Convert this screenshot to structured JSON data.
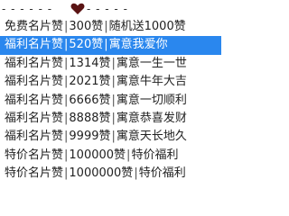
{
  "header": {
    "left_dashes": "- - - - - -",
    "right_dashes": "- - - - -",
    "heart_icon": "heart-icon"
  },
  "menu": {
    "items": [
      {
        "name": "免费名片赞",
        "count": "300赞",
        "desc": "随机送1000赞",
        "selected": false
      },
      {
        "name": "福利名片赞",
        "count": "520赞",
        "desc": "寓意我爱你",
        "selected": true
      },
      {
        "name": "福利名片赞",
        "count": "1314赞",
        "desc": "寓意一生一世",
        "selected": false
      },
      {
        "name": "福利名片赞",
        "count": "2021赞",
        "desc": "寓意牛年大吉",
        "selected": false
      },
      {
        "name": "福利名片赞",
        "count": "6666赞",
        "desc": "寓意一切顺利",
        "selected": false
      },
      {
        "name": "福利名片赞",
        "count": "8888赞",
        "desc": "寓意恭喜发财",
        "selected": false
      },
      {
        "name": "福利名片赞",
        "count": "9999赞",
        "desc": "寓意天长地久",
        "selected": false
      },
      {
        "name": "特价名片赞",
        "count": "100000赞",
        "desc": "特价福利",
        "selected": false
      },
      {
        "name": "特价名片赞",
        "count": "1000000赞",
        "desc": "特价福利",
        "selected": false
      }
    ],
    "separator": "|"
  },
  "colors": {
    "selected_bg": "#2a87ee",
    "selected_text": "#ffffff",
    "heart": "#5a1414"
  }
}
